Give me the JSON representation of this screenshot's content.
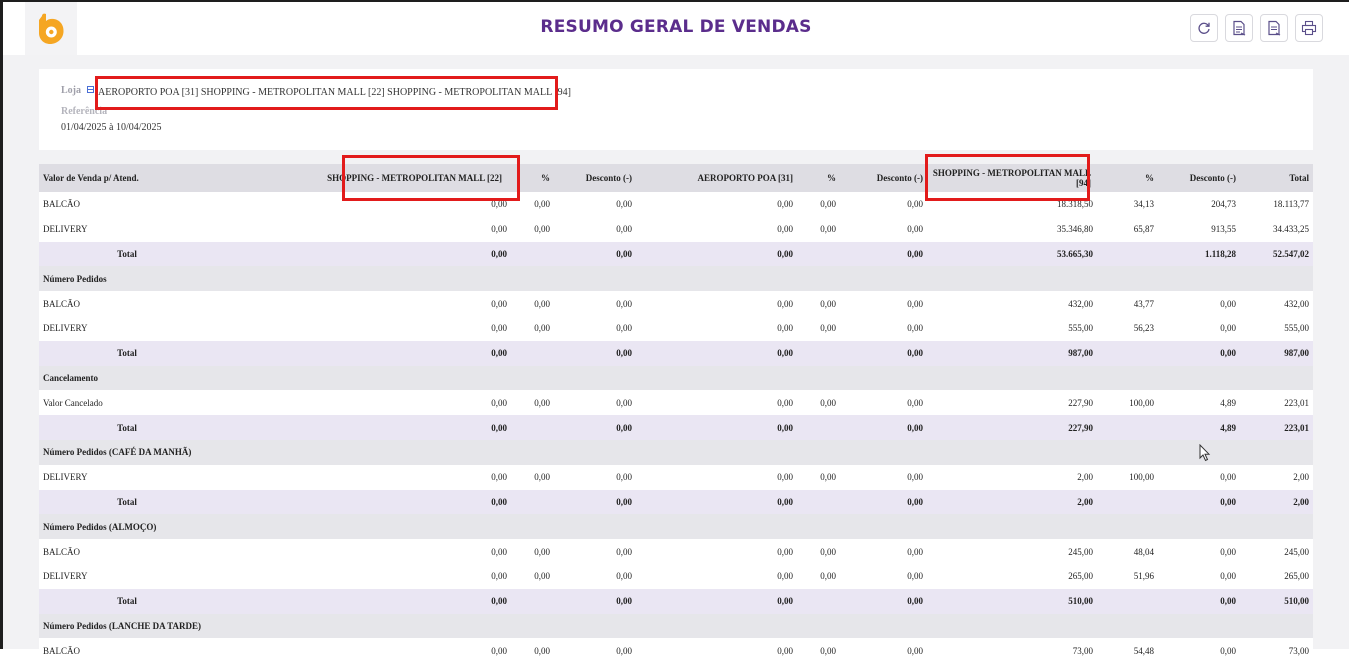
{
  "header": {
    "title": "RESUMO GERAL DE VENDAS",
    "buttons": [
      "refresh-icon",
      "export-excel-icon",
      "export-pdf-icon",
      "print-icon"
    ],
    "accent_color": "#5b2d8c",
    "logo_color": "#f5a623"
  },
  "filters": {
    "loja_label": "Loja",
    "loja_value": "AEROPORTO POA [31] SHOPPING - METROPOLITAN MALL [22] SHOPPING - METROPOLITAN MALL [94]",
    "referencia_label": "Referência",
    "referencia_value": "01/04/2025 à 10/04/2025"
  },
  "table": {
    "columns": [
      "Valor de Venda p/ Atend.",
      "SHOPPING - METROPOLITAN MALL [22]",
      "%",
      "Desconto (-)",
      "AEROPORTO POA [31]",
      "%",
      "Desconto (-)",
      "SHOPPING - METROPOLITAN MALL [94]",
      "%",
      "Desconto (-)",
      "Total"
    ],
    "rows": [
      {
        "type": "data",
        "cells": [
          "BALCÃO",
          "0,00",
          "0,00",
          "0,00",
          "0,00",
          "0,00",
          "0,00",
          "18.318,50",
          "34,13",
          "204,73",
          "18.113,77"
        ]
      },
      {
        "type": "data",
        "cells": [
          "DELIVERY",
          "0,00",
          "0,00",
          "0,00",
          "0,00",
          "0,00",
          "0,00",
          "35.346,80",
          "65,87",
          "913,55",
          "34.433,25"
        ]
      },
      {
        "type": "total",
        "cells": [
          "Total",
          "0,00",
          "",
          "0,00",
          "0,00",
          "",
          "0,00",
          "53.665,30",
          "",
          "1.118,28",
          "52.547,02"
        ]
      },
      {
        "type": "section",
        "cells": [
          "Número Pedidos"
        ]
      },
      {
        "type": "data",
        "cells": [
          "BALCÃO",
          "0,00",
          "0,00",
          "0,00",
          "0,00",
          "0,00",
          "0,00",
          "432,00",
          "43,77",
          "0,00",
          "432,00"
        ]
      },
      {
        "type": "data",
        "cells": [
          "DELIVERY",
          "0,00",
          "0,00",
          "0,00",
          "0,00",
          "0,00",
          "0,00",
          "555,00",
          "56,23",
          "0,00",
          "555,00"
        ]
      },
      {
        "type": "total",
        "cells": [
          "Total",
          "0,00",
          "",
          "0,00",
          "0,00",
          "",
          "0,00",
          "987,00",
          "",
          "0,00",
          "987,00"
        ]
      },
      {
        "type": "section",
        "cells": [
          "Cancelamento"
        ]
      },
      {
        "type": "data",
        "cells": [
          "Valor Cancelado",
          "0,00",
          "0,00",
          "0,00",
          "0,00",
          "0,00",
          "0,00",
          "227,90",
          "100,00",
          "4,89",
          "223,01"
        ]
      },
      {
        "type": "total",
        "cells": [
          "Total",
          "0,00",
          "",
          "0,00",
          "0,00",
          "",
          "0,00",
          "227,90",
          "",
          "4,89",
          "223,01"
        ]
      },
      {
        "type": "section",
        "cells": [
          "Número Pedidos (CAFÉ DA MANHÃ)"
        ]
      },
      {
        "type": "data",
        "cells": [
          "DELIVERY",
          "0,00",
          "0,00",
          "0,00",
          "0,00",
          "0,00",
          "0,00",
          "2,00",
          "100,00",
          "0,00",
          "2,00"
        ]
      },
      {
        "type": "total",
        "cells": [
          "Total",
          "0,00",
          "",
          "0,00",
          "0,00",
          "",
          "0,00",
          "2,00",
          "",
          "0,00",
          "2,00"
        ]
      },
      {
        "type": "section",
        "cells": [
          "Número Pedidos (ALMOÇO)"
        ]
      },
      {
        "type": "data",
        "cells": [
          "BALCÃO",
          "0,00",
          "0,00",
          "0,00",
          "0,00",
          "0,00",
          "0,00",
          "245,00",
          "48,04",
          "0,00",
          "245,00"
        ]
      },
      {
        "type": "data",
        "cells": [
          "DELIVERY",
          "0,00",
          "0,00",
          "0,00",
          "0,00",
          "0,00",
          "0,00",
          "265,00",
          "51,96",
          "0,00",
          "265,00"
        ]
      },
      {
        "type": "total",
        "cells": [
          "Total",
          "0,00",
          "",
          "0,00",
          "0,00",
          "",
          "0,00",
          "510,00",
          "",
          "0,00",
          "510,00"
        ]
      },
      {
        "type": "section",
        "cells": [
          "Número Pedidos (LANCHE DA TARDE)"
        ]
      },
      {
        "type": "data",
        "cells": [
          "BALCÃO",
          "0,00",
          "0,00",
          "0,00",
          "0,00",
          "0,00",
          "0,00",
          "73,00",
          "54,48",
          "0,00",
          "73,00"
        ]
      }
    ]
  },
  "highlight_color": "#e21b1b"
}
